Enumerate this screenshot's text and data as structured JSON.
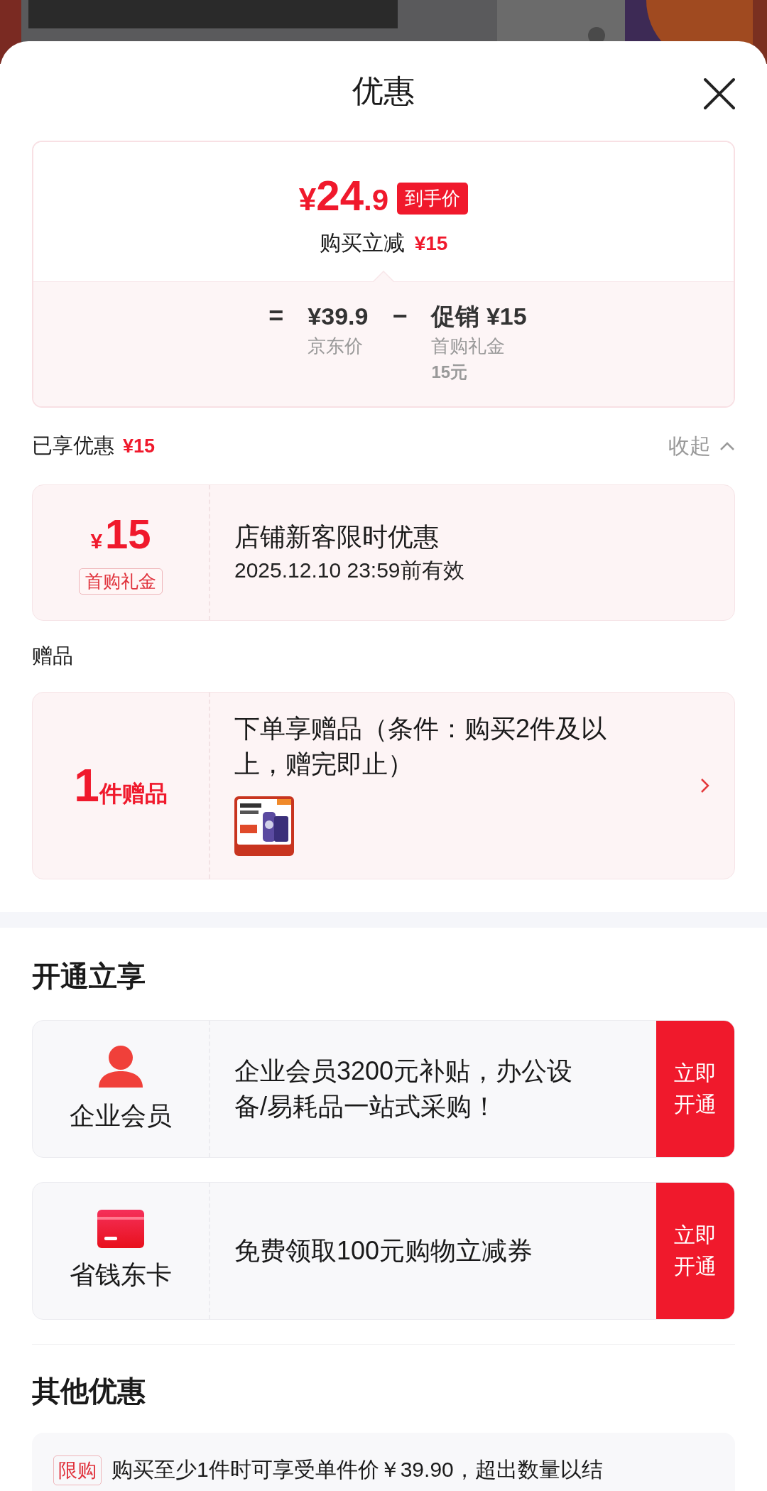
{
  "sheet": {
    "title": "优惠"
  },
  "price_summary": {
    "final_price": "¥24.9",
    "badge": "到手价",
    "discount_label": "购买立减",
    "discount_amount": "¥15",
    "breakdown": [
      {
        "kind": "operator",
        "text": "="
      },
      {
        "kind": "term",
        "value": "¥39.9",
        "notes": [
          "京东价"
        ]
      },
      {
        "kind": "operator",
        "text": "−"
      },
      {
        "kind": "term",
        "value": "促销 ¥15",
        "notes": [
          "首购礼金",
          "15元"
        ]
      }
    ]
  },
  "applied": {
    "label": "已享优惠",
    "amount": "¥15",
    "toggle": "收起",
    "expanded": true
  },
  "coupons": [
    {
      "amount": "¥15",
      "tag": "首购礼金",
      "title": "店铺新客限时优惠",
      "validity": "2025.12.10 23:59前有效"
    }
  ],
  "gifts": {
    "heading": "赠品",
    "items": [
      {
        "count": "1",
        "unit": "件赠品",
        "description": "下单享赠品（条件：购买2件及以上，赠完即止）"
      }
    ]
  },
  "membership": {
    "heading": "开通立享",
    "offers": [
      {
        "kind": "member",
        "name": "企业会员",
        "description": "企业会员3200元补贴，办公设备/易耗品一站式采购！",
        "action": "立即开通"
      },
      {
        "kind": "card",
        "name": "省钱东卡",
        "description": "免费领取100元购物立减券",
        "action": "立即开通"
      }
    ]
  },
  "other": {
    "heading": "其他优惠",
    "items": [
      {
        "tag": "限购",
        "text": "购买至少1件时可享受单件价￥39.90，超出数量以结"
      }
    ]
  }
}
